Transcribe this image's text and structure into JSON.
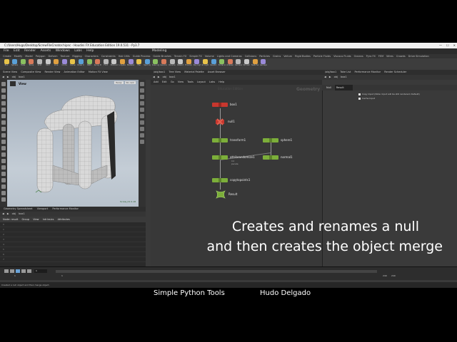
{
  "window": {
    "title": "C:/Users/Hugo/Desktop/ScrewFileCreator.hipnc - Houdini FX Education Edition 19.0.531 - Py3.7"
  },
  "menu": [
    "File",
    "Edit",
    "Render",
    "Assets",
    "Windows",
    "Labs",
    "Help"
  ],
  "workspace": "Modeling",
  "shelf_tabs": [
    "Create",
    "Modify",
    "Model",
    "Polygon",
    "Deform",
    "Texture",
    "Rigging",
    "Characters",
    "Constraints",
    "Hair Utils",
    "Guide Process",
    "Guide Brushes",
    "Terrain FX",
    "Simple FX",
    "Volume",
    "Lights and Cameras",
    "Collisions",
    "Particles",
    "Grains",
    "Vellum",
    "Rigid Bodies",
    "Particle Fluids",
    "Viscous Fluids",
    "Oceans",
    "Pyro FX",
    "FEM",
    "Wires",
    "Crowds",
    "Drive Simulation"
  ],
  "shelf_tools": [
    "Box",
    "Sphere",
    "Tube",
    "Torus",
    "Grid",
    "Null",
    "Line",
    "Circle",
    "Curve",
    "Draw Curve",
    "Path",
    "Spray Paint",
    "Font",
    "Platonic Solids",
    "L-System",
    "Metaball",
    "File",
    "Spot Light",
    "Area Light",
    "Geometry Light",
    "Volume Light",
    "Distant Light",
    "Environment Light",
    "Sky Light",
    "GI Light",
    "Caustic Light",
    "Portal Light",
    "Ambient Light",
    "Camera",
    "VR Camera",
    "Switcher",
    "Gamepad Camera"
  ],
  "left_tabs": [
    "Scene View",
    "Composite View",
    "Render View",
    "Animation Editor",
    "Motion FX View"
  ],
  "left_path": [
    "obj",
    "box1"
  ],
  "viewport": {
    "label": "View",
    "camera_buttons": [
      "Persp",
      "No cam"
    ],
    "info": "Screw_01 0.18"
  },
  "sheet_tabs": [
    "Geometry Spreadsheet",
    "Viewport",
    "Performance Monitor"
  ],
  "sheet_path": [
    "obj",
    "box1"
  ],
  "sheet_header": [
    "Node: result",
    "Group",
    "View",
    "Intrinsics",
    "Attributes"
  ],
  "sheet_rows": [
    "0",
    "1",
    "2",
    "3",
    "4",
    "5",
    "6",
    "7"
  ],
  "sheet_footer": "Attribute",
  "net_tabs": [
    "/obj/box1",
    "Tree View",
    "Material Palette",
    "Asset Browser"
  ],
  "net_path": [
    "obj",
    "box1"
  ],
  "net_menu": [
    "Add",
    "Edit",
    "Go",
    "View",
    "Tools",
    "Layout",
    "Labs",
    "Help"
  ],
  "net_context": "Geometry",
  "net_context_sub": "Education Edition",
  "nodes": [
    {
      "label": "box1",
      "color": "#c8372e"
    },
    {
      "label": "null1",
      "color": "#c8372e"
    },
    {
      "label": "transform1",
      "color": "#7cae3a"
    },
    {
      "label": "sphere1",
      "color": "#7cae3a"
    },
    {
      "label": "attribrandomize1",
      "color": "#7cae3a"
    },
    {
      "label": "normal1",
      "color": "#7cae3a"
    },
    {
      "label": "copytopoints1",
      "color": "#7cae3a"
    },
    {
      "label": "Result",
      "color": "#7cae3a"
    }
  ],
  "node_subs": [
    "Cd",
    "pscale"
  ],
  "parm_tabs": [
    "/obj/box1",
    "Take List",
    "Performance Monitor",
    "Render Scheduler"
  ],
  "parm_path": [
    "obj",
    "box1"
  ],
  "parm_node": {
    "type": "Null",
    "name": "Result"
  },
  "parm_checks": [
    "Copy Input (Note: Input will be still rendered, Default)",
    "Cache Input"
  ],
  "subtitle": [
    "Creates and renames a null",
    "and then creates the object merge"
  ],
  "timeline": {
    "frame": "1",
    "start": "1",
    "end": "240",
    "end2": "240",
    "start2": "1"
  },
  "status": "Created a null object and then merge object.",
  "credits": [
    "Simple Python Tools",
    "Hudo Delgado"
  ]
}
